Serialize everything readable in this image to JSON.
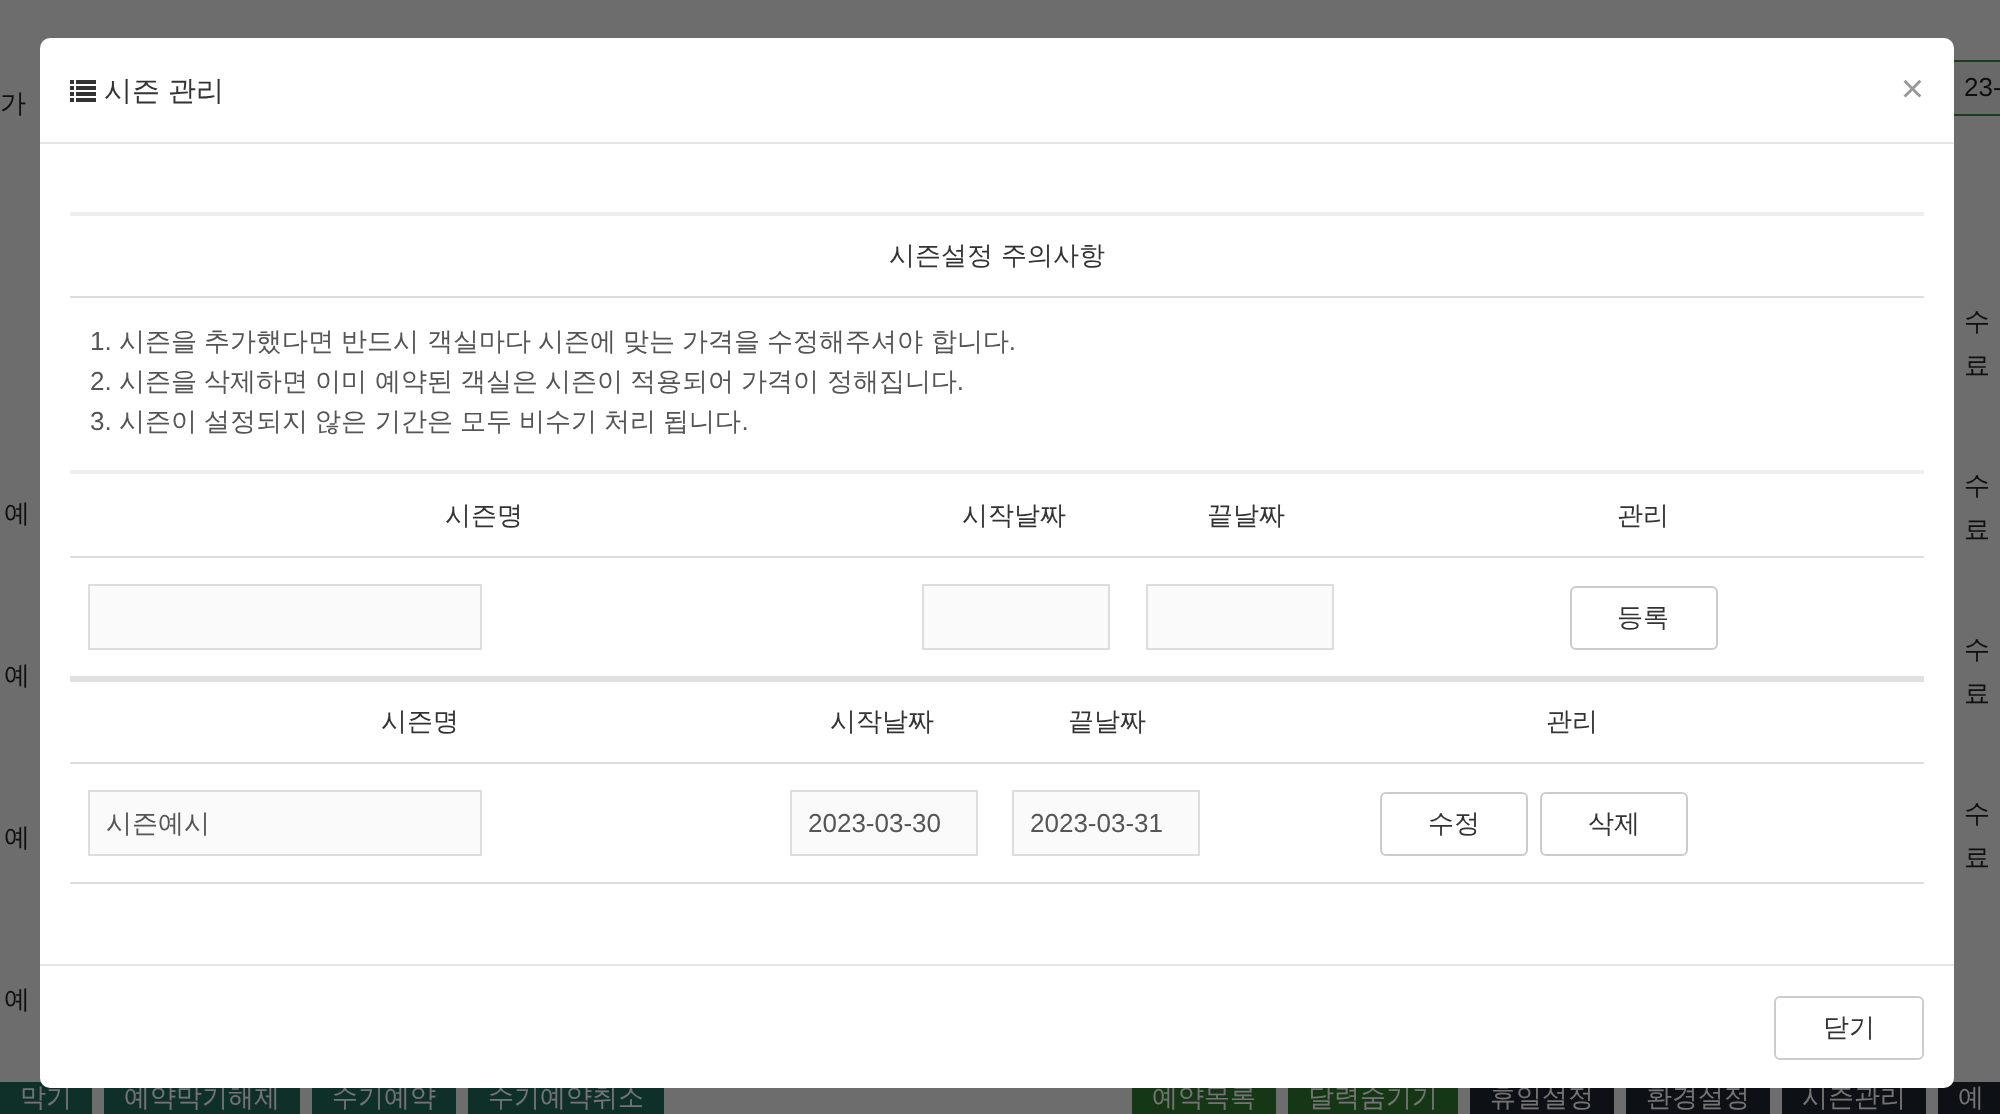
{
  "background": {
    "left_fragments": [
      "가",
      "예",
      "예",
      "예",
      "예"
    ],
    "top_right_fragment": "23-",
    "right_fragments": [
      [
        "수",
        "료"
      ],
      [
        "수",
        "료"
      ],
      [
        "수",
        "료"
      ],
      [
        "수",
        "료"
      ]
    ],
    "bottom_buttons": [
      {
        "label": "막기",
        "kind": "booking"
      },
      {
        "label": "예약막기해제",
        "kind": "booking"
      },
      {
        "label": "수기예약",
        "kind": "booking"
      },
      {
        "label": "수기예약취소",
        "kind": "booking"
      },
      {
        "label": "예약목록",
        "kind": "view"
      },
      {
        "label": "달력숨기기",
        "kind": "view"
      },
      {
        "label": "휴일설정",
        "kind": "settings"
      },
      {
        "label": "환경설정",
        "kind": "settings"
      },
      {
        "label": "시즌관리",
        "kind": "settings"
      },
      {
        "label": "예",
        "kind": "settings"
      }
    ]
  },
  "dialog": {
    "title": "시즌 관리",
    "close": "×",
    "notice_title": "시즌설정 주의사항",
    "notices": [
      "1. 시즌을 추가했다면 반드시 객실마다 시즌에 맞는 가격을 수정해주셔야 합니다.",
      "2. 시즌을 삭제하면 이미 예약된 객실은 시즌이 적용되어 가격이 정해집니다.",
      "3. 시즌이 설정되지 않은 기간은 모두 비수기 처리 됩니다."
    ],
    "add_table": {
      "columns": [
        "시즌명",
        "시작날짜",
        "끝날짜",
        "관리"
      ],
      "row": {
        "button": "등록"
      }
    },
    "list_table": {
      "columns": [
        "시즌명",
        "시작날짜",
        "끝날짜",
        "관리"
      ],
      "rows": [
        {
          "name": "시즌예시",
          "start": "2023-03-30",
          "end": "2023-03-31",
          "edit": "수정",
          "delete": "삭제"
        }
      ]
    },
    "footer_button": "닫기"
  }
}
